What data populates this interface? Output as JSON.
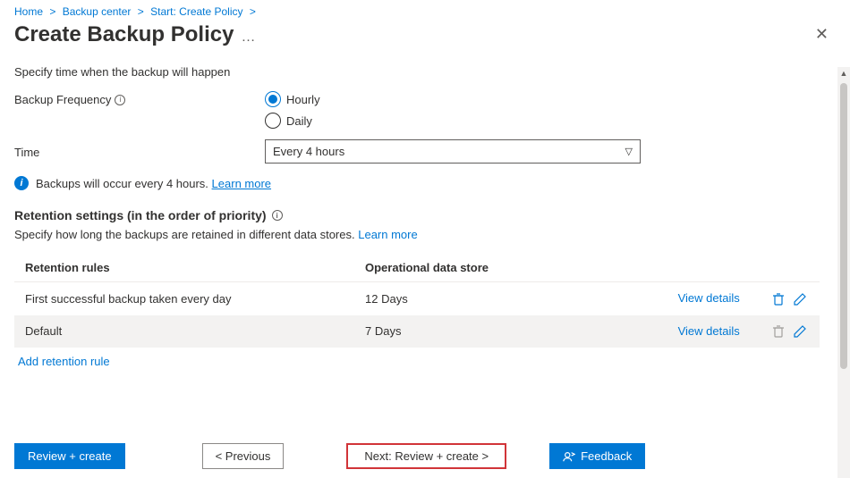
{
  "breadcrumb": {
    "items": [
      "Home",
      "Backup center",
      "Start: Create Policy"
    ]
  },
  "header": {
    "title": "Create Backup Policy"
  },
  "form": {
    "spec_text": "Specify time when the backup will happen",
    "frequency_label": "Backup Frequency",
    "frequency_options": {
      "hourly": "Hourly",
      "daily": "Daily"
    },
    "time_label": "Time",
    "time_value": "Every 4 hours",
    "info_banner": "Backups will occur every 4 hours.",
    "learn_more": "Learn more"
  },
  "retention": {
    "heading": "Retention settings (in the order of priority)",
    "subtext": "Specify how long the backups are retained in different data stores.",
    "learn_more": "Learn more",
    "columns": {
      "rules": "Retention rules",
      "store": "Operational data store"
    },
    "rows": [
      {
        "rule": "First successful backup taken every day",
        "store": "12 Days",
        "view": "View details",
        "delete_enabled": true
      },
      {
        "rule": "Default",
        "store": "7 Days",
        "view": "View details",
        "delete_enabled": false
      }
    ],
    "add_rule": "Add retention rule"
  },
  "footer": {
    "review_create": "Review + create",
    "previous": "< Previous",
    "next": "Next: Review + create >",
    "feedback": "Feedback"
  }
}
